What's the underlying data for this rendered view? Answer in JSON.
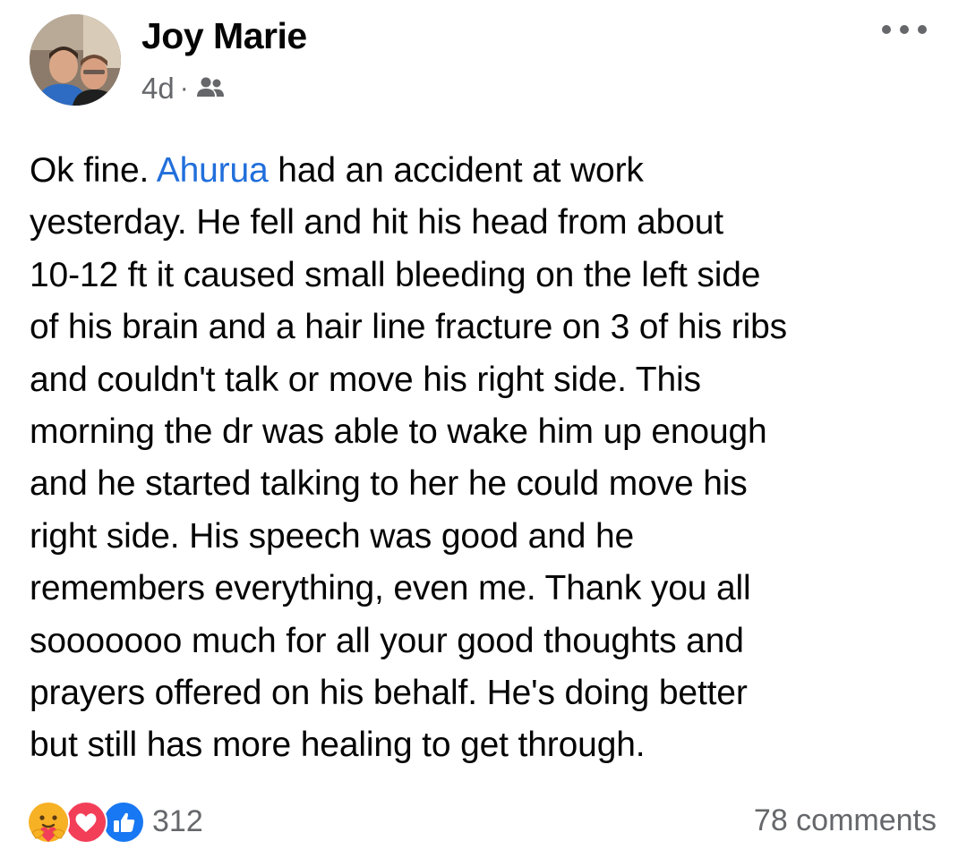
{
  "post": {
    "author": "Joy Marie",
    "time": "4d",
    "separator": "·",
    "audience_icon": "friends-icon",
    "more_icon": "more-horizontal-icon",
    "body": {
      "line1_before": "Ok fine. ",
      "mention": "Ahurua",
      "line1_after": " had an accident at work",
      "lines": [
        "yesterday. He fell and hit his head from about",
        "10-12 ft it caused small bleeding on the left side",
        "of his brain and a hair line fracture on 3 of his ribs",
        "and couldn't talk or move his right side. This",
        "morning the dr was able to wake him up enough",
        "and he started talking to her he could move his",
        "right side. His speech was good and he",
        "remembers everything, even me. Thank you all",
        "sooooooo much for all your good thoughts and",
        "prayers offered on his behalf. He's doing better",
        "but still has more healing to get through."
      ]
    },
    "reactions": {
      "icons": [
        "care-icon",
        "love-icon",
        "like-icon"
      ],
      "count": "312"
    },
    "comments": "78 comments"
  },
  "colors": {
    "text": "#050505",
    "secondary_text": "#65676b",
    "mention": "#216fdb",
    "like_blue": "#1877f2",
    "love_red": "#f33e58",
    "care_yellow": "#f7b125"
  }
}
